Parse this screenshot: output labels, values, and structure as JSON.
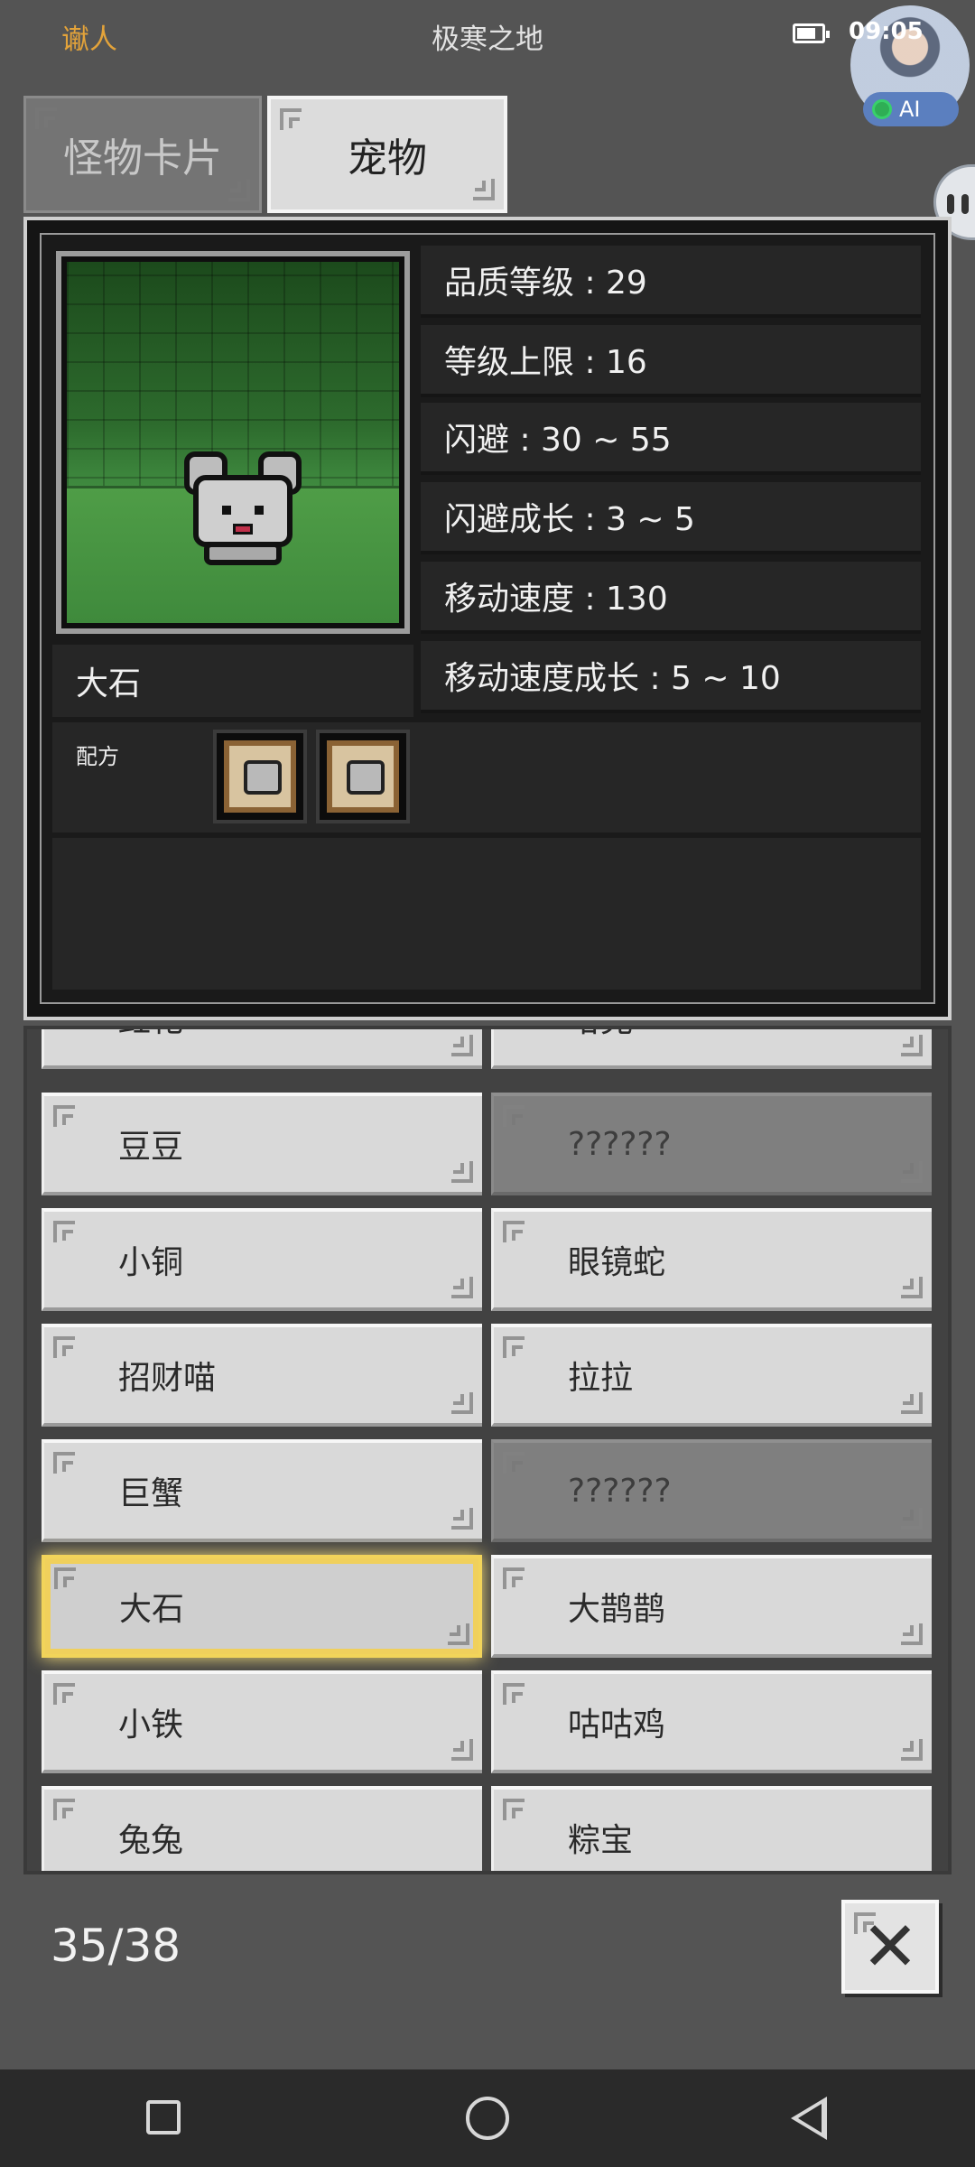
{
  "status_bar": {
    "user": "谳人",
    "title": "极寒之地",
    "time": "09:05",
    "ai_badge": "AI"
  },
  "tabs": [
    {
      "label": "怪物卡片",
      "active": false
    },
    {
      "label": "宠物",
      "active": true
    }
  ],
  "detail": {
    "pet_name": "大石",
    "stats": [
      "品质等级 : 29",
      "等级上限 : 16",
      "闪避 : 30 ~ 55",
      "闪避成长 : 3 ~ 5",
      "移动速度 : 130",
      "移动速度成长 : 5 ~ 10"
    ],
    "recipe_label": "配方"
  },
  "pet_list": {
    "partial_top": [
      "豇花",
      "哈克"
    ],
    "rows": [
      [
        "豆豆",
        "??????"
      ],
      [
        "小铜",
        "眼镜蛇"
      ],
      [
        "招财喵",
        "拉拉"
      ],
      [
        "巨蟹",
        "??????"
      ],
      [
        "大石",
        "大鹊鹊"
      ],
      [
        "小铁",
        "咕咕鸡"
      ],
      [
        "兔兔",
        "粽宝"
      ]
    ],
    "selected": "大石"
  },
  "footer": {
    "counter": "35/38",
    "close_icon": "close-icon"
  },
  "colors": {
    "accent_user": "#e3a33a",
    "selected_highlight": "#f2d45a",
    "background": "#545454"
  }
}
